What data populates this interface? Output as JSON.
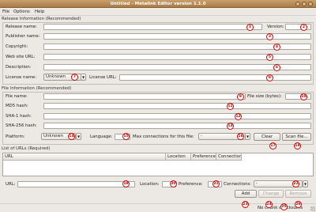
{
  "window": {
    "title": "Untitled - Metalink Editor version 1.1.0"
  },
  "menu": [
    "File",
    "Options",
    "Help"
  ],
  "release": {
    "section_title": "Release Information (Recommended)",
    "release_name_label": "Release name:",
    "version_label": "Version:",
    "publisher_name_label": "Publisher name:",
    "copyright_label": "Copyright:",
    "website_label": "Web site URL:",
    "description_label": "Description:",
    "license_name_label": "License name:",
    "license_name_value": "Unknown",
    "license_url_label": "License URL:"
  },
  "file": {
    "section_title": "File Information (Recommended)",
    "file_name_label": "File name:",
    "file_size_label": "File size (bytes):",
    "md5_label": "MD5 hash:",
    "sha1_label": "SHA-1 hash:",
    "sha256_label": "SHA-256 hash:",
    "platform_label": "Platform:",
    "platform_value": "Unknown",
    "language_label": "Language:",
    "maxconn_label": "Max connections for this file:",
    "maxconn_value": "-",
    "clear_label": "Clear",
    "scan_label": "Scan file..."
  },
  "urls": {
    "section_title": "List of URLs (Required)",
    "columns": [
      "URL",
      "Location",
      "Preference",
      "Connections"
    ],
    "url_label": "URL:",
    "location_label": "Location:",
    "preference_label": "Preference:",
    "connections_label": "Connections:",
    "connections_value": "-",
    "add_label": "Add",
    "change_label": "Change",
    "remove_label": "Remove"
  },
  "status": {
    "text": "No chunk checksums"
  },
  "badges": [
    "1",
    "2",
    "3",
    "4",
    "5",
    "6",
    "7",
    "8",
    "9",
    "10",
    "11",
    "12",
    "13",
    "14",
    "15",
    "16",
    "17",
    "18",
    "19",
    "20",
    "21",
    "22",
    "23",
    "24",
    "25",
    "26"
  ],
  "colors": {
    "title_bar": "#b58752",
    "badge_ring": "#d10000",
    "window_bg": "#ece9e4"
  }
}
